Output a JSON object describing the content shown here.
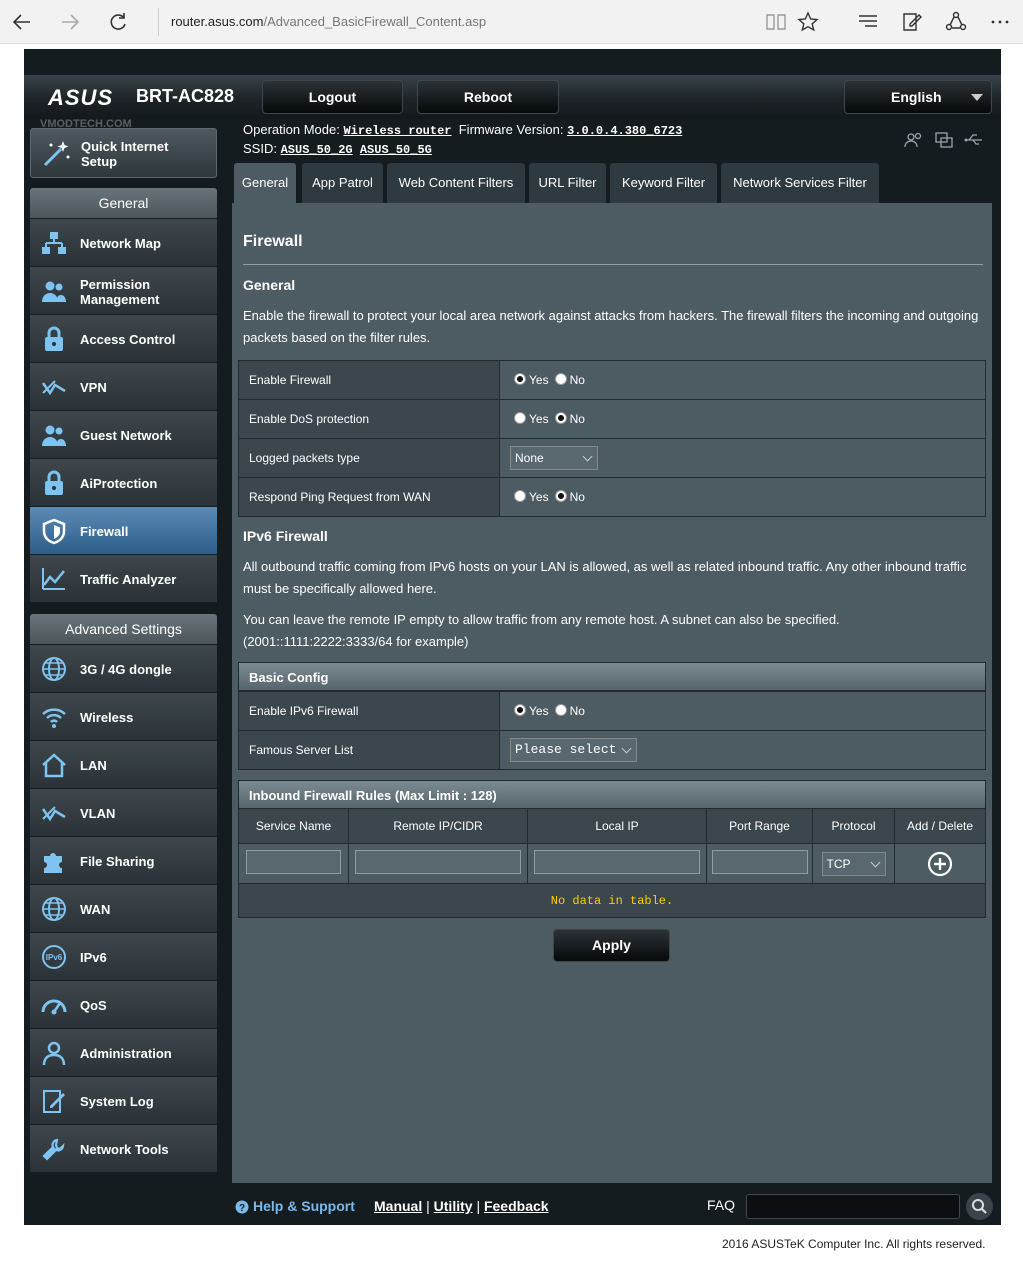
{
  "browser": {
    "url_host": "router.asus.com",
    "url_path": "/Advanced_BasicFirewall_Content.asp"
  },
  "header": {
    "brand": "ASUS",
    "model": "BRT-AC828",
    "logout": "Logout",
    "reboot": "Reboot",
    "language": "English",
    "watermark": "VMODTECH.COM"
  },
  "status": {
    "op_mode_label": "Operation Mode:",
    "op_mode": "Wireless router",
    "fw_label": "Firmware Version:",
    "fw": "3.0.0.4.380_6723",
    "ssid_label": "SSID:",
    "ssid1": "ASUS_50_2G",
    "ssid2": "ASUS_50_5G"
  },
  "sidebar": {
    "quick_setup": "Quick Internet Setup",
    "general_header": "General",
    "general": [
      {
        "label": "Network Map"
      },
      {
        "label": "Permission Management"
      },
      {
        "label": "Access Control"
      },
      {
        "label": "VPN"
      },
      {
        "label": "Guest Network"
      },
      {
        "label": "AiProtection"
      },
      {
        "label": "Firewall"
      },
      {
        "label": "Traffic Analyzer"
      }
    ],
    "advanced_header": "Advanced Settings",
    "advanced": [
      {
        "label": "3G / 4G dongle"
      },
      {
        "label": "Wireless"
      },
      {
        "label": "LAN"
      },
      {
        "label": "VLAN"
      },
      {
        "label": "File Sharing"
      },
      {
        "label": "WAN"
      },
      {
        "label": "IPv6"
      },
      {
        "label": "QoS"
      },
      {
        "label": "Administration"
      },
      {
        "label": "System Log"
      },
      {
        "label": "Network Tools"
      }
    ]
  },
  "tabs": [
    "General",
    "App Patrol",
    "Web Content Filters",
    "URL Filter",
    "Keyword Filter",
    "Network Services Filter"
  ],
  "main": {
    "title": "Firewall",
    "general_heading": "General",
    "general_desc": "Enable the firewall to protect your local area network against attacks from hackers. The firewall filters the incoming and outgoing packets based on the filter rules.",
    "rows": [
      {
        "label": "Enable Firewall",
        "value": "Yes"
      },
      {
        "label": "Enable DoS protection",
        "value": "No"
      },
      {
        "label": "Logged packets type",
        "value": "None"
      },
      {
        "label": "Respond Ping Request from WAN",
        "value": "No"
      }
    ],
    "yes": "Yes",
    "no": "No",
    "ipv6_heading": "IPv6 Firewall",
    "ipv6_desc1": "All outbound traffic coming from IPv6 hosts on your LAN is allowed, as well as related inbound traffic. Any other inbound traffic must be specifically allowed here.",
    "ipv6_desc2": "You can leave the remote IP empty to allow traffic from any remote host. A subnet can also be specified. (2001::1111:2222:3333/64 for example)",
    "basic_config": "Basic Config",
    "ipv6_rows": [
      {
        "label": "Enable IPv6 Firewall",
        "value": "Yes"
      },
      {
        "label": "Famous Server List",
        "value": "Please select"
      }
    ],
    "rules_title": "Inbound Firewall Rules (Max Limit : 128)",
    "columns": [
      "Service Name",
      "Remote IP/CIDR",
      "Local IP",
      "Port Range",
      "Protocol",
      "Add / Delete"
    ],
    "protocol": "TCP",
    "no_data": "No data in table.",
    "apply": "Apply"
  },
  "footer": {
    "help": "Help & Support",
    "manual": "Manual",
    "utility": "Utility",
    "feedback": "Feedback",
    "sep": "|",
    "faq": "FAQ",
    "copyright": "2016 ASUSTeK Computer Inc. All rights reserved."
  }
}
